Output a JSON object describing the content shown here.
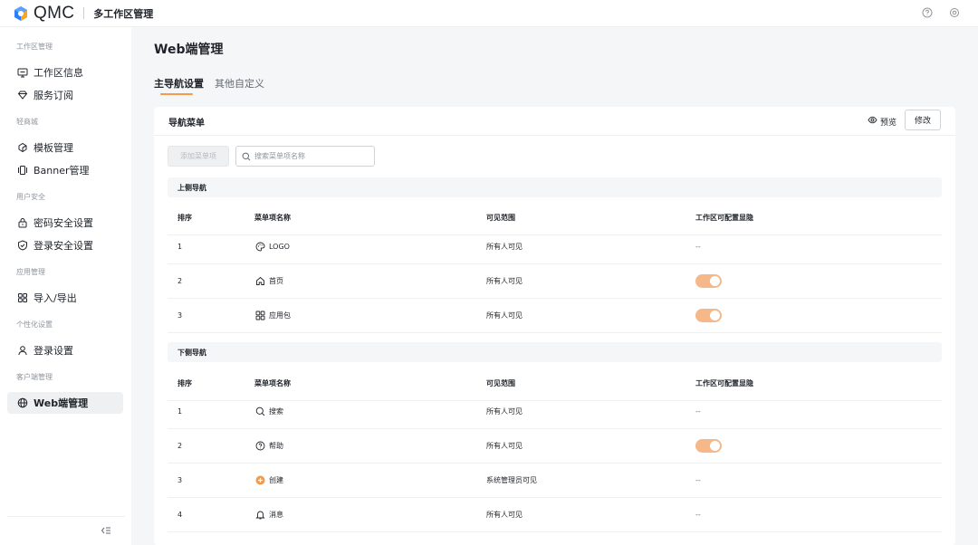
{
  "header": {
    "brand": "QMC",
    "workspace_title": "多工作区管理",
    "icons": [
      "help-icon",
      "settings-icon"
    ]
  },
  "sidebar": {
    "groups": [
      {
        "title": "工作区管理",
        "items": [
          {
            "label": "工作区信息",
            "icon": "monitor-icon"
          },
          {
            "label": "服务订阅",
            "icon": "diamond-icon"
          }
        ]
      },
      {
        "title": "轻商城",
        "items": [
          {
            "label": "模板管理",
            "icon": "template-icon"
          },
          {
            "label": "Banner管理",
            "icon": "banner-icon"
          }
        ]
      },
      {
        "title": "用户安全",
        "items": [
          {
            "label": "密码安全设置",
            "icon": "lock-icon"
          },
          {
            "label": "登录安全设置",
            "icon": "shield-icon"
          }
        ]
      },
      {
        "title": "应用管理",
        "items": [
          {
            "label": "导入/导出",
            "icon": "grid-icon"
          }
        ]
      },
      {
        "title": "个性化设置",
        "items": [
          {
            "label": "登录设置",
            "icon": "user-icon"
          }
        ]
      },
      {
        "title": "客户端管理",
        "items": [
          {
            "label": "Web端管理",
            "icon": "globe-icon",
            "active": true
          }
        ]
      }
    ]
  },
  "main": {
    "page_title": "Web端管理",
    "tabs": [
      {
        "label": "主导航设置",
        "active": true
      },
      {
        "label": "其他自定义",
        "active": false
      }
    ],
    "card": {
      "title": "导航菜单",
      "preview_label": "预览",
      "edit_label": "修改",
      "add_button_label": "添加菜单项",
      "search_placeholder": "搜索菜单项名称",
      "columns": [
        "排序",
        "菜单项名称",
        "可见范围",
        "工作区可配置显隐"
      ],
      "sections": [
        {
          "title": "上侧导航",
          "rows": [
            {
              "order": "1",
              "name": "LOGO",
              "icon": "palette-icon",
              "visibility": "所有人可见",
              "configurable": "--"
            },
            {
              "order": "2",
              "name": "首页",
              "icon": "home-icon",
              "visibility": "所有人可见",
              "configurable": "toggle-on"
            },
            {
              "order": "3",
              "name": "应用包",
              "icon": "apps-icon",
              "visibility": "所有人可见",
              "configurable": "toggle-on"
            }
          ]
        },
        {
          "title": "下侧导航",
          "rows": [
            {
              "order": "1",
              "name": "搜索",
              "icon": "search-icon",
              "visibility": "所有人可见",
              "configurable": "--"
            },
            {
              "order": "2",
              "name": "帮助",
              "icon": "help-icon",
              "visibility": "所有人可见",
              "configurable": "toggle-on"
            },
            {
              "order": "3",
              "name": "创建",
              "icon": "plus-circle-icon",
              "visibility": "系统管理员可见",
              "configurable": "--"
            },
            {
              "order": "4",
              "name": "消息",
              "icon": "bell-icon",
              "visibility": "所有人可见",
              "configurable": "--"
            }
          ]
        }
      ]
    }
  },
  "colors": {
    "accent": "#f39a4b",
    "toggle_on": "#f6b888",
    "logo_blue": "#2d7ff9",
    "create_icon": "#f39a4b"
  }
}
